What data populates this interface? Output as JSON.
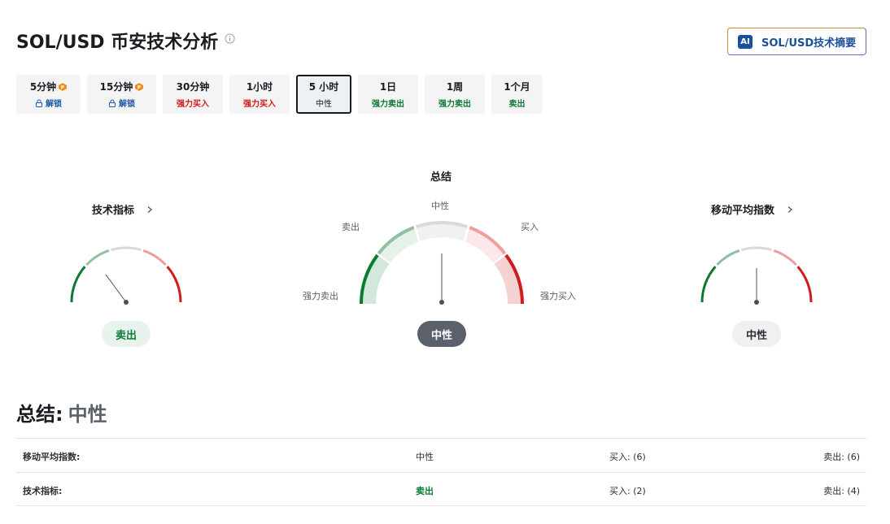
{
  "header": {
    "title": "SOL/USD 币安技术分析",
    "ai_button_badge": "AI",
    "ai_button_label": "SOL/USD技术摘要"
  },
  "tabs": [
    {
      "label": "5分钟",
      "sub": "解锁",
      "locked": true
    },
    {
      "label": "15分钟",
      "sub": "解锁",
      "locked": true
    },
    {
      "label": "30分钟",
      "sub": "强力买入"
    },
    {
      "label": "1小时",
      "sub": "强力买入"
    },
    {
      "label": "5 小时",
      "sub": "中性",
      "active": true
    },
    {
      "label": "1日",
      "sub": "强力卖出"
    },
    {
      "label": "1周",
      "sub": "强力卖出"
    },
    {
      "label": "1个月",
      "sub": "卖出"
    }
  ],
  "gauges": {
    "technical": {
      "title": "技术指标",
      "result": "卖出"
    },
    "summary": {
      "title": "总结",
      "result": "中性",
      "labels": {
        "strong_sell": "强力卖出",
        "sell": "卖出",
        "neutral": "中性",
        "buy": "买入",
        "strong_buy": "强力买入"
      }
    },
    "moving_avg": {
      "title": "移动平均指数",
      "result": "中性"
    }
  },
  "summary": {
    "heading": "总结:",
    "value": "中性"
  },
  "table": [
    {
      "name": "移动平均指数:",
      "status": "中性",
      "buy": "买入: (6)",
      "sell": "卖出: (6)"
    },
    {
      "name": "技术指标:",
      "status": "卖出",
      "buy": "买入: (2)",
      "sell": "卖出: (4)"
    }
  ],
  "colors": {
    "strong_sell": "#0b7a33",
    "sell": "#8fc0a0",
    "neutral_arc": "#d9d9d9",
    "buy": "#ef9d9d",
    "strong_buy": "#cf1d1d",
    "sell_text": "#0b7a33",
    "buy_text": "#d11a1a",
    "unlock_text": "#1f5ba8",
    "pro_icon": "#f08a1c"
  }
}
